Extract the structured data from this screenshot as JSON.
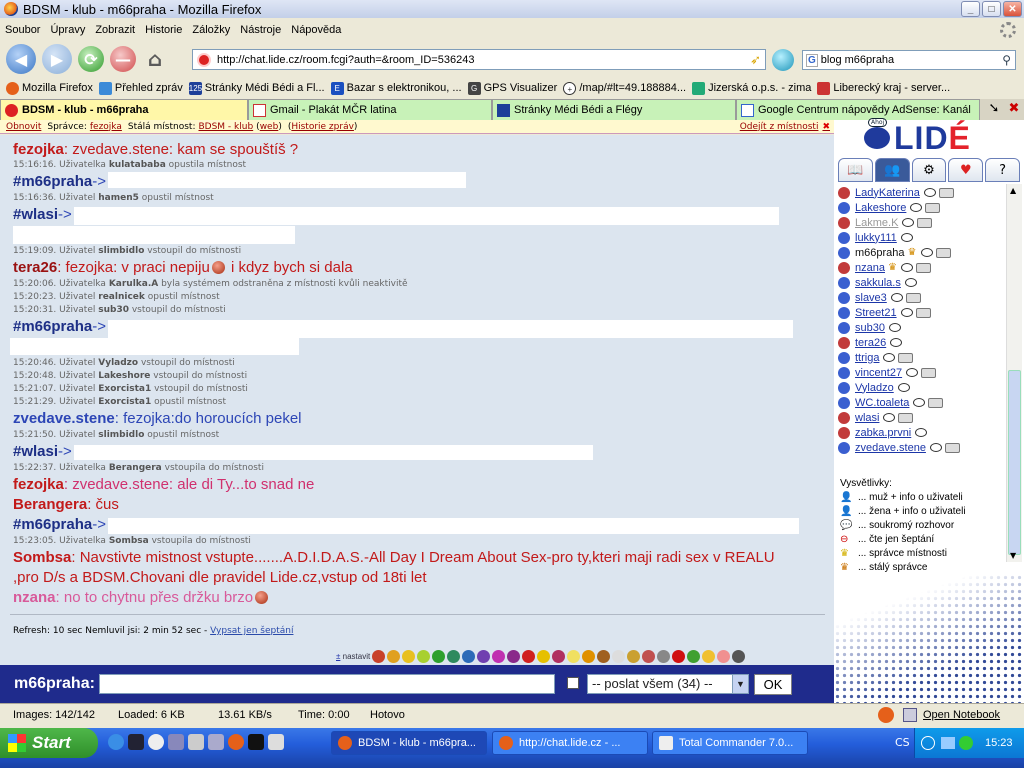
{
  "window": {
    "title": "BDSM - klub - m66praha - Mozilla Firefox"
  },
  "menu": [
    "Soubor",
    "Úpravy",
    "Zobrazit",
    "Historie",
    "Záložky",
    "Nástroje",
    "Nápověda"
  ],
  "nav": {
    "url": "http://chat.lide.cz/room.fcgi?auth=&room_ID=536243",
    "search_value": "blog m66praha"
  },
  "bookmarks": [
    {
      "label": "Mozilla Firefox",
      "color": "#e5601a"
    },
    {
      "label": "Přehled zpráv",
      "color": "#3b8ad8"
    },
    {
      "label": "Stránky Médi Bédi a Fl...",
      "color": "#1d3f99"
    },
    {
      "label": "Bazar s elektronikou, ...",
      "color": "#1a4fc0"
    },
    {
      "label": "GPS Visualizer",
      "color": "#444"
    },
    {
      "label": "/map/#lt=49.188884...",
      "color": "#333"
    },
    {
      "label": "Jizerská o.p.s. - zima",
      "color": "#2a7"
    },
    {
      "label": "Liberecký kraj - server...",
      "color": "#c33"
    }
  ],
  "tabs": [
    {
      "label": "BDSM - klub - m66praha",
      "w": 248
    },
    {
      "label": "Gmail - Plakát MČR latina",
      "w": 244
    },
    {
      "label": "Stránky Médi Bédi a Flégy",
      "w": 244
    },
    {
      "label": "Google Centrum nápovědy AdSense: Kanál",
      "w": 244
    }
  ],
  "roombar": {
    "refresh": "Obnovit",
    "admin_label": "Správce:",
    "admin": "fezojka",
    "room_label": "Stálá místnost:",
    "room": "BDSM - klub",
    "web": "web",
    "history": "Historie zpráv",
    "exit": "Odejít z místnosti"
  },
  "chat": {
    "m1": {
      "nick": "fezojka",
      "text": ": zvedave.stene: kam se spouštíš ?"
    },
    "s1": {
      "time": "15:16:16.",
      "pre": " Uživatelka ",
      "name": "kulatababa",
      "post": " opustila místnost"
    },
    "m2": {
      "nick": "#m66praha",
      "text": "->"
    },
    "s2": {
      "time": "15:16:36.",
      "pre": " Uživatel ",
      "name": "hamen5",
      "post": " opustil místnost"
    },
    "m3": {
      "nick": "#wlasi",
      "text": "->"
    },
    "s3": {
      "time": "15:19:09.",
      "pre": " Uživatel ",
      "name": "slimbidlo",
      "post": " vstoupil do místnosti"
    },
    "m4": {
      "nick": "tera26",
      "text": ": fezojka: v praci nepiju",
      "text2": " i kdyz bych si dala"
    },
    "s4": {
      "time": "15:20:06.",
      "pre": " Uživatelka ",
      "name": "Karulka.A",
      "post": " byla systémem odstraněna z místnosti kvůli neaktivitě"
    },
    "s5": {
      "time": "15:20:23.",
      "pre": " Uživatel ",
      "name": "realnicek",
      "post": " opustil místnost"
    },
    "s6": {
      "time": "15:20:31.",
      "pre": " Uživatel ",
      "name": "sub30",
      "post": " vstoupil do místnosti"
    },
    "m5": {
      "nick": "#m66praha",
      "text": "->"
    },
    "s7": {
      "time": "15:20:46.",
      "pre": " Uživatel ",
      "name": "Vyladzo",
      "post": " vstoupil do místnosti"
    },
    "s8": {
      "time": "15:20:48.",
      "pre": " Uživatel ",
      "name": "Lakeshore",
      "post": " vstoupil do místnosti"
    },
    "s9": {
      "time": "15:21:07.",
      "pre": " Uživatel ",
      "name": "Exorcista1",
      "post": " vstoupil do místnosti"
    },
    "s10": {
      "time": "15:21:29.",
      "pre": " Uživatel ",
      "name": "Exorcista1",
      "post": " opustil místnost"
    },
    "m6": {
      "nick": "zvedave.stene",
      "text": ": fezojka:do horoucích pekel"
    },
    "s11": {
      "time": "15:21:50.",
      "pre": " Uživatel ",
      "name": "slimbidlo",
      "post": " opustil místnost"
    },
    "m7": {
      "nick": "#wlasi",
      "text": "->"
    },
    "s12": {
      "time": "15:22:37.",
      "pre": " Uživatelka ",
      "name": "Berangera",
      "post": " vstoupila do místnosti"
    },
    "m8": {
      "nick": "fezojka",
      "text": ": zvedave.stene: ale di Ty...to snad ne"
    },
    "m9": {
      "nick": "Berangera",
      "text": ": čus"
    },
    "m10": {
      "nick": "#m66praha",
      "text": "->"
    },
    "s13": {
      "time": "15:23:05.",
      "pre": " Uživatelka ",
      "name": "Sombsa",
      "post": " vstoupila do místnosti"
    },
    "m11": {
      "nick": "Sombsa",
      "text": ": Navstivte mistnost vstupte.......A.D.I.D.A.S.-All Day I Dream About Sex-pro ty,kteri maji radi sex v REALU",
      "text2": ",pro D/s a BDSM.Chovani dle pravidel Lide.cz,vstup od 18ti let"
    },
    "m12": {
      "nick": "nzana",
      "text": ": no to chytnu přes držku brzo"
    }
  },
  "refreshline": {
    "text": "Refresh: 10 sec   Nemluvil jsi: 2 min 52 sec - ",
    "link": "Vypsat jen šeptání"
  },
  "emoticons": {
    "label": "nastavit",
    "plus": "±"
  },
  "input": {
    "nick": "m66praha:",
    "select": "-- poslat všem (34) --",
    "ok": "OK"
  },
  "logo": {
    "prefix": "LID",
    "suffix": "É"
  },
  "users": [
    {
      "name": "LadyKaterina",
      "g": "f",
      "cam": true
    },
    {
      "name": "Lakeshore",
      "g": "m",
      "cam": true
    },
    {
      "name": "Lakme.K",
      "g": "f",
      "cam": true,
      "gray": true
    },
    {
      "name": "lukky111",
      "g": "m",
      "cam": false
    },
    {
      "name": "m66praha",
      "g": "m",
      "cam": true,
      "self": true
    },
    {
      "name": "nzana",
      "g": "f",
      "cam": true,
      "crown": true
    },
    {
      "name": "sakkula.s",
      "g": "m",
      "cam": false
    },
    {
      "name": "slave3",
      "g": "m",
      "cam": true
    },
    {
      "name": "Street21",
      "g": "m",
      "cam": true
    },
    {
      "name": "sub30",
      "g": "m",
      "cam": false
    },
    {
      "name": "tera26",
      "g": "f",
      "cam": false
    },
    {
      "name": "ttriga",
      "g": "m",
      "cam": true
    },
    {
      "name": "vincent27",
      "g": "m",
      "cam": true
    },
    {
      "name": "Vyladzo",
      "g": "m",
      "cam": false
    },
    {
      "name": "WC.toaleta",
      "g": "m",
      "cam": true
    },
    {
      "name": "wlasi",
      "g": "f",
      "cam": true
    },
    {
      "name": "zabka.prvni",
      "g": "f",
      "cam": false
    },
    {
      "name": "zvedave.stene",
      "g": "m",
      "cam": true
    }
  ],
  "legend": {
    "title": "Vysvětlivky:",
    "rows": [
      "... muž + info o uživateli",
      "... žena + info o uživateli",
      "... soukromý rozhovor",
      "... čte jen šeptání",
      "... správce místnosti",
      "... stálý správce"
    ]
  },
  "status": {
    "images": "Images: 142/142",
    "loaded": "Loaded: 6 KB",
    "speed": "13.61 KB/s",
    "time": "Time: 0:00",
    "state": "Hotovo",
    "notebook": "Open Notebook"
  },
  "taskbar": {
    "start": "Start",
    "tasks": [
      "BDSM - klub - m66pra...",
      "http://chat.lide.cz - ...",
      "Total Commander 7.0..."
    ],
    "lang": "CS",
    "clock": "15:23"
  },
  "colors": {
    "male": "#3a5fd0",
    "female": "#c23b3b"
  }
}
